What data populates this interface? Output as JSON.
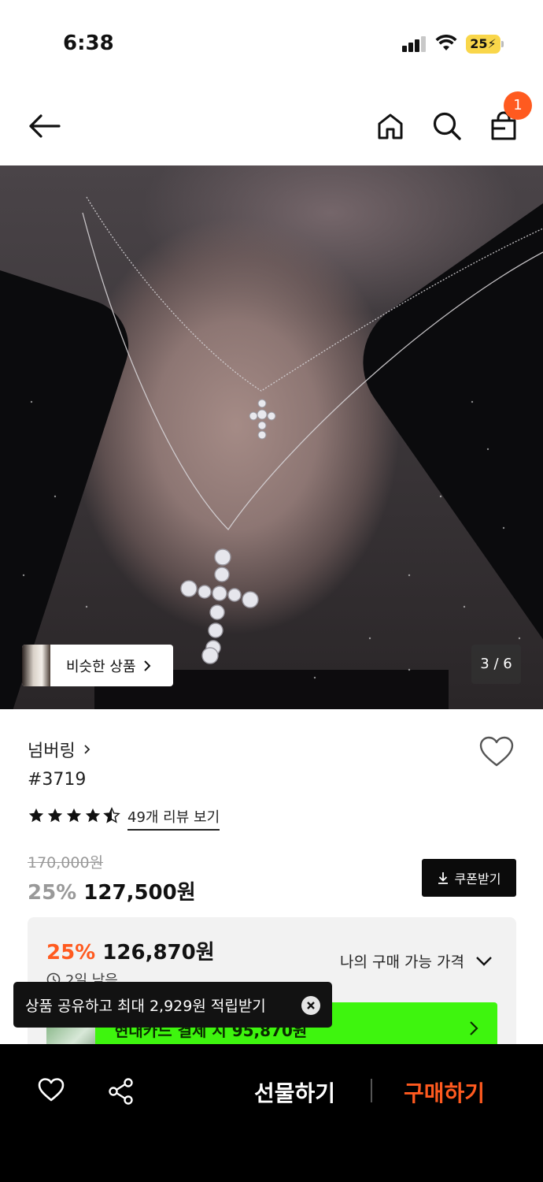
{
  "status_bar": {
    "time": "6:38",
    "battery": "25"
  },
  "header": {
    "cart_count": "1",
    "icons": [
      "back-arrow-icon",
      "home-icon",
      "search-icon",
      "cart-icon"
    ]
  },
  "gallery": {
    "similar_label": "비슷한 상품",
    "page_indicator": "3 / 6"
  },
  "product": {
    "brand": "넘버링",
    "name": "#3719",
    "rating": 4.5,
    "review_link": "49개 리뷰 보기",
    "original_price": "170,000원",
    "discount": "25%",
    "price": "127,500원",
    "coupon_label": "쿠폰받기"
  },
  "member_card": {
    "discount": "25%",
    "price": "126,870원",
    "remaining": "2일 남음",
    "my_price_label": "나의 구매 가능 가격",
    "card_offer": "현대카드 결제 시 95,870원"
  },
  "toast": {
    "message": "상품 공유하고 최대 2,929원 적립받기"
  },
  "bottom_bar": {
    "gift_label": "선물하기",
    "buy_label": "구매하기"
  },
  "colors": {
    "accent": "#ff5a1f",
    "card_green": "#3ef50e",
    "dark": "#000000"
  }
}
